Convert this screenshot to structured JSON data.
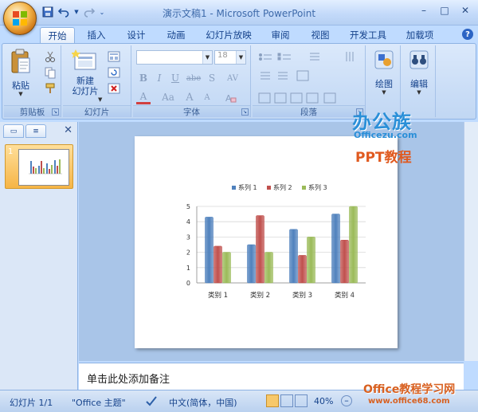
{
  "window": {
    "title": "演示文稿1 - Microsoft PowerPoint",
    "minimize": "–",
    "maximize": "□",
    "close": "✕"
  },
  "qat": {
    "save_icon": "save-icon",
    "undo_icon": "undo-icon",
    "redo_icon": "redo-icon"
  },
  "tabs": [
    {
      "label": "开始",
      "active": true
    },
    {
      "label": "插入"
    },
    {
      "label": "设计"
    },
    {
      "label": "动画"
    },
    {
      "label": "幻灯片放映"
    },
    {
      "label": "审阅"
    },
    {
      "label": "视图"
    },
    {
      "label": "开发工具"
    },
    {
      "label": "加载项"
    }
  ],
  "ribbon": {
    "clipboard": {
      "label": "剪贴板",
      "paste": "粘贴"
    },
    "slides": {
      "label": "幻灯片",
      "new_slide_line1": "新建",
      "new_slide_line2": "幻灯片"
    },
    "font": {
      "label": "字体",
      "font_size": "18",
      "bold": "B",
      "italic": "I",
      "underline": "U",
      "strike": "abe",
      "shadow": "S",
      "spacing": "AV",
      "font_color": "A",
      "case": "Aa",
      "grow": "A",
      "shrink": "A"
    },
    "paragraph": {
      "label": "段落"
    },
    "drawing": {
      "label": "绘图"
    },
    "editing": {
      "label": "编辑"
    }
  },
  "leftpane": {
    "slide_number": "1"
  },
  "brand": {
    "name": "办公族",
    "site": "Officezu.com",
    "tag": "PPT教程"
  },
  "notes": {
    "placeholder": "单击此处添加备注"
  },
  "status": {
    "slide": "幻灯片 1/1",
    "theme": "\"Office 主题\"",
    "language": "中文(简体，中国)",
    "zoom": "40%"
  },
  "watermark": {
    "name": "Office教程学习网",
    "url": "www.office68.com"
  },
  "colors": {
    "series1": "#4f81bd",
    "series2": "#c0504d",
    "series3": "#9bbb59"
  },
  "chart_data": {
    "type": "bar",
    "categories": [
      "类别 1",
      "类别 2",
      "类别 3",
      "类别 4"
    ],
    "series": [
      {
        "name": "系列 1",
        "values": [
          4.3,
          2.5,
          3.5,
          4.5
        ]
      },
      {
        "name": "系列 2",
        "values": [
          2.4,
          4.4,
          1.8,
          2.8
        ]
      },
      {
        "name": "系列 3",
        "values": [
          2,
          2,
          3,
          5
        ]
      }
    ],
    "ylim": [
      0,
      5
    ],
    "yticks": [
      "0",
      "1",
      "2",
      "3",
      "4",
      "5"
    ],
    "legend": "top",
    "grid": true
  }
}
